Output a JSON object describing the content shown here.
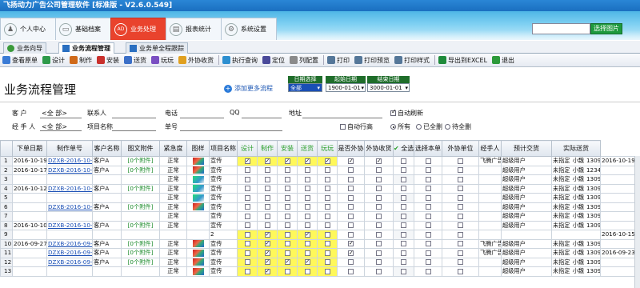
{
  "window": {
    "title": "飞扬动力广告公司管理软件 [标准版 - V2.6.0.549]"
  },
  "main_tabs": [
    {
      "label": "个人中心",
      "icon": "user-icon",
      "glyph": "♟"
    },
    {
      "label": "基础档案",
      "icon": "archive-icon",
      "glyph": "▭"
    },
    {
      "label": "业务处理",
      "icon": "ad-icon",
      "glyph": "AD"
    },
    {
      "label": "报表统计",
      "icon": "chart-icon",
      "glyph": "▤"
    },
    {
      "label": "系统设置",
      "icon": "gear-icon",
      "glyph": "⚙"
    }
  ],
  "skin": {
    "button_label": "选择图片"
  },
  "sub_tabs": [
    "业务向导",
    "业务流程管理",
    "业务单全程跟踪"
  ],
  "toolbar": [
    {
      "label": "查看原单",
      "icon": "view-icon",
      "color": "#3a7bd5"
    },
    {
      "label": "设计",
      "icon": "design-icon",
      "color": "#2e9a4a"
    },
    {
      "label": "制作",
      "icon": "make-icon",
      "color": "#d06a1a"
    },
    {
      "label": "安装",
      "icon": "install-icon",
      "color": "#c9302c"
    },
    {
      "label": "送货",
      "icon": "deliver-icon",
      "color": "#3b6fc7"
    },
    {
      "label": "玩玩",
      "icon": "play-icon",
      "color": "#7a4fc2"
    },
    {
      "label": "外协收货",
      "icon": "receive-icon",
      "color": "#e0a020"
    },
    {
      "label": "执行查询",
      "icon": "query-icon",
      "color": "#2d8fd0"
    },
    {
      "label": "定位",
      "icon": "locate-icon",
      "color": "#4a4a9a"
    },
    {
      "label": "列配置",
      "icon": "columns-icon",
      "color": "#8a8a8a"
    },
    {
      "label": "打印",
      "icon": "print-icon",
      "color": "#557799"
    },
    {
      "label": "打印预览",
      "icon": "print-preview-icon",
      "color": "#557799"
    },
    {
      "label": "打印样式",
      "icon": "print-style-icon",
      "color": "#557799"
    },
    {
      "label": "导出到EXCEL",
      "icon": "excel-icon",
      "color": "#1e8a3a"
    },
    {
      "label": "退出",
      "icon": "exit-icon",
      "color": "#2d9a3a"
    }
  ],
  "page": {
    "title": "业务流程管理",
    "add_flow": "添加更多流程"
  },
  "date_filters": {
    "type": {
      "header": "日期选择",
      "value": "全部"
    },
    "start": {
      "header": "起始日期",
      "value": "1900-01-01"
    },
    "end": {
      "header": "结束日期",
      "value": "3000-01-01"
    }
  },
  "criteria": {
    "customer_label": "客    户",
    "customer_value": "<全 部>",
    "contact_label": "联系人",
    "phone_label": "电话",
    "qq_label": "QQ",
    "address_label": "地址",
    "auto_refresh": "自动刷新",
    "handler_label": "经 手 人",
    "handler_value": "<全 部>",
    "project_label": "项目名称",
    "order_label": "单号",
    "auto_wrap": "自动行高",
    "radio_all": "所有",
    "radio_sent": "已全删",
    "radio_pending": "待全删"
  },
  "table": {
    "headers": [
      "",
      "下单日期",
      "制作单号",
      "客户名称",
      "图文附件",
      "紧急度",
      "图样",
      "项目名称",
      "设计",
      "制作",
      "安装",
      "送货",
      "玩玩",
      "是否外协",
      "外协收货",
      "全选",
      "选择本单",
      "外协单位",
      "经手人",
      "预计交货",
      "实际送货"
    ],
    "rows": [
      {
        "idx": "1",
        "date": "2016-10-19",
        "no": "DZXB-2016-10-19",
        "cust": "客户A",
        "att": "[0个附件]",
        "urgency": "正常",
        "thumb": "a",
        "proj": "宣传",
        "checks": [
          1,
          1,
          1,
          1,
          1,
          1,
          1,
          0,
          0,
          0
        ],
        "vendor": "飞腾广告",
        "handler": "超级用户",
        "eta": "未指定",
        "ppl": "小魏",
        "phone": "1309987",
        "actual": "2016-10-19 13:50"
      },
      {
        "idx": "2",
        "date": "2016-10-17",
        "no": "DZXB-2016-10-17",
        "cust": "客户A",
        "att": "[0个附件]",
        "urgency": "正常",
        "thumb": "a",
        "proj": "宣传",
        "checks": [
          0,
          0,
          0,
          0,
          0,
          0,
          0,
          0,
          0,
          0
        ],
        "vendor": "",
        "handler": "超级用户",
        "eta": "未指定",
        "ppl": "小魏",
        "phone": "1234500",
        "actual": ""
      },
      {
        "idx": "3",
        "date": "",
        "no": "",
        "cust": "",
        "att": "",
        "urgency": "正常",
        "thumb": "b",
        "proj": "宣传",
        "checks": [
          0,
          0,
          0,
          0,
          0,
          0,
          0,
          0,
          0,
          0
        ],
        "vendor": "",
        "handler": "超级用户",
        "eta": "未指定",
        "ppl": "小魏",
        "phone": "1309987",
        "actual": ""
      },
      {
        "idx": "4",
        "date": "2016-10-12",
        "no": "DZXB-2016-10-12",
        "cust": "客户A",
        "att": "[0个附件]",
        "urgency": "正常",
        "thumb": "b",
        "proj": "宣传",
        "checks": [
          0,
          0,
          0,
          0,
          0,
          0,
          0,
          0,
          0,
          0
        ],
        "vendor": "",
        "handler": "超级用户",
        "eta": "未指定",
        "ppl": "小魏",
        "phone": "1309987",
        "actual": ""
      },
      {
        "idx": "5",
        "date": "",
        "no": "",
        "cust": "",
        "att": "",
        "urgency": "正常",
        "thumb": "b",
        "proj": "宣传",
        "checks": [
          0,
          0,
          0,
          0,
          0,
          0,
          0,
          0,
          0,
          0
        ],
        "vendor": "",
        "handler": "超级用户",
        "eta": "未指定",
        "ppl": "小魏",
        "phone": "1309987",
        "actual": ""
      },
      {
        "idx": "6",
        "date": "",
        "no": "DZXB-2016-10-12",
        "cust": "客户A",
        "att": "[0个附件]",
        "urgency": "正常",
        "thumb": "a",
        "proj": "宣传",
        "checks": [
          0,
          0,
          0,
          0,
          0,
          0,
          0,
          0,
          0,
          0
        ],
        "vendor": "",
        "handler": "超级用户",
        "eta": "未指定",
        "ppl": "小魏",
        "phone": "1309987",
        "actual": ""
      },
      {
        "idx": "7",
        "date": "",
        "no": "",
        "cust": "",
        "att": "",
        "urgency": "正常",
        "thumb": "",
        "proj": "宣传",
        "checks": [
          0,
          0,
          0,
          0,
          0,
          0,
          0,
          0,
          0,
          0
        ],
        "vendor": "",
        "handler": "超级用户",
        "eta": "未指定",
        "ppl": "小魏",
        "phone": "1309987",
        "actual": ""
      },
      {
        "idx": "8",
        "date": "2016-10-10",
        "no": "DZXB-2016-10-10",
        "cust": "客户A",
        "att": "[0个附件]",
        "urgency": "正常",
        "thumb": "",
        "proj": "宣传",
        "checks": [
          0,
          0,
          0,
          0,
          0,
          0,
          0,
          0,
          0,
          0
        ],
        "vendor": "",
        "handler": "超级用户",
        "eta": "未指定",
        "ppl": "小魏",
        "phone": "1309987",
        "actual": ""
      },
      {
        "idx": "9",
        "date": "",
        "no": "",
        "cust": "",
        "att": "",
        "urgency": "",
        "thumb": "",
        "proj": "2",
        "checks": [
          0,
          1,
          0,
          1,
          0,
          0,
          0,
          0,
          0,
          0
        ],
        "vendor": "",
        "handler": "",
        "eta": "",
        "ppl": "",
        "phone": "",
        "actual": "2016-10-15 14:56"
      },
      {
        "idx": "10",
        "date": "2016-09-27",
        "no": "DZXB-2016-09-27",
        "cust": "客户A",
        "att": "[0个附件]",
        "urgency": "正常",
        "thumb": "a",
        "proj": "宣传",
        "checks": [
          0,
          1,
          0,
          0,
          0,
          1,
          0,
          0,
          0,
          0
        ],
        "vendor": "飞腾广告",
        "handler": "超级用户",
        "eta": "未指定",
        "ppl": "小魏",
        "phone": "1309987",
        "actual": ""
      },
      {
        "idx": "11",
        "date": "",
        "no": "DZXB-2016-09-27",
        "cust": "客户A",
        "att": "[0个附件]",
        "urgency": "正常",
        "thumb": "a",
        "proj": "宣传",
        "checks": [
          0,
          1,
          0,
          0,
          0,
          1,
          0,
          0,
          0,
          0
        ],
        "vendor": "飞腾广告",
        "handler": "超级用户",
        "eta": "未指定",
        "ppl": "小魏",
        "phone": "1309987",
        "actual": "2016-09-23 15:05"
      },
      {
        "idx": "12",
        "date": "",
        "no": "DZXB-2016-09-22",
        "cust": "客户A",
        "att": "[0个附件]",
        "urgency": "正常",
        "thumb": "a",
        "proj": "宣传",
        "checks": [
          0,
          1,
          1,
          1,
          0,
          0,
          0,
          0,
          0,
          0
        ],
        "vendor": "",
        "handler": "超级用户",
        "eta": "未指定",
        "ppl": "小魏",
        "phone": "1309987",
        "actual": ""
      },
      {
        "idx": "13",
        "date": "",
        "no": "",
        "cust": "",
        "att": "",
        "urgency": "正常",
        "thumb": "a",
        "proj": "宣传",
        "checks": [
          0,
          1,
          0,
          0,
          0,
          0,
          0,
          0,
          0,
          0
        ],
        "vendor": "",
        "handler": "超级用户",
        "eta": "未指定",
        "ppl": "小魏",
        "phone": "1309987",
        "actual": ""
      }
    ]
  }
}
